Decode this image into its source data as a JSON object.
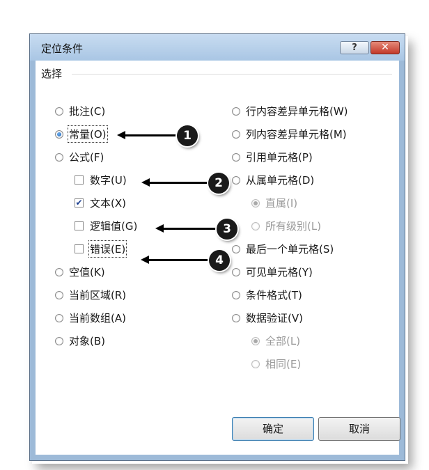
{
  "dialog": {
    "title": "定位条件",
    "help_label": "?",
    "close_label": "✕",
    "group_label": "选择"
  },
  "left_options": [
    {
      "label": "批注(C)",
      "kind": "radio",
      "checked": false,
      "disabled": false
    },
    {
      "label": "常量(O)",
      "kind": "radio",
      "checked": true,
      "disabled": false
    },
    {
      "label": "公式(F)",
      "kind": "radio",
      "checked": false,
      "disabled": false
    },
    {
      "label": "数字(U)",
      "kind": "checkbox",
      "checked": false,
      "disabled": false
    },
    {
      "label": "文本(X)",
      "kind": "checkbox",
      "checked": true,
      "disabled": false
    },
    {
      "label": "逻辑值(G)",
      "kind": "checkbox",
      "checked": false,
      "disabled": false
    },
    {
      "label": "错误(E)",
      "kind": "checkbox",
      "checked": false,
      "disabled": false
    },
    {
      "label": "空值(K)",
      "kind": "radio",
      "checked": false,
      "disabled": false
    },
    {
      "label": "当前区域(R)",
      "kind": "radio",
      "checked": false,
      "disabled": false
    },
    {
      "label": "当前数组(A)",
      "kind": "radio",
      "checked": false,
      "disabled": false
    },
    {
      "label": "对象(B)",
      "kind": "radio",
      "checked": false,
      "disabled": false
    }
  ],
  "right_options": [
    {
      "label": "行内容差异单元格(W)",
      "kind": "radio",
      "checked": false,
      "disabled": false
    },
    {
      "label": "列内容差异单元格(M)",
      "kind": "radio",
      "checked": false,
      "disabled": false
    },
    {
      "label": "引用单元格(P)",
      "kind": "radio",
      "checked": false,
      "disabled": false
    },
    {
      "label": "从属单元格(D)",
      "kind": "radio",
      "checked": false,
      "disabled": false
    },
    {
      "label": "直属(I)",
      "kind": "radio",
      "checked": true,
      "disabled": true
    },
    {
      "label": "所有级别(L)",
      "kind": "radio",
      "checked": false,
      "disabled": true
    },
    {
      "label": "最后一个单元格(S)",
      "kind": "radio",
      "checked": false,
      "disabled": false
    },
    {
      "label": "可见单元格(Y)",
      "kind": "radio",
      "checked": false,
      "disabled": false
    },
    {
      "label": "条件格式(T)",
      "kind": "radio",
      "checked": false,
      "disabled": false
    },
    {
      "label": "数据验证(V)",
      "kind": "radio",
      "checked": false,
      "disabled": false
    },
    {
      "label": "全部(L)",
      "kind": "radio",
      "checked": true,
      "disabled": true
    },
    {
      "label": "相同(E)",
      "kind": "radio",
      "checked": false,
      "disabled": true
    }
  ],
  "buttons": {
    "ok": "确定",
    "cancel": "取消"
  },
  "callouts": [
    "1",
    "2",
    "3",
    "4"
  ]
}
